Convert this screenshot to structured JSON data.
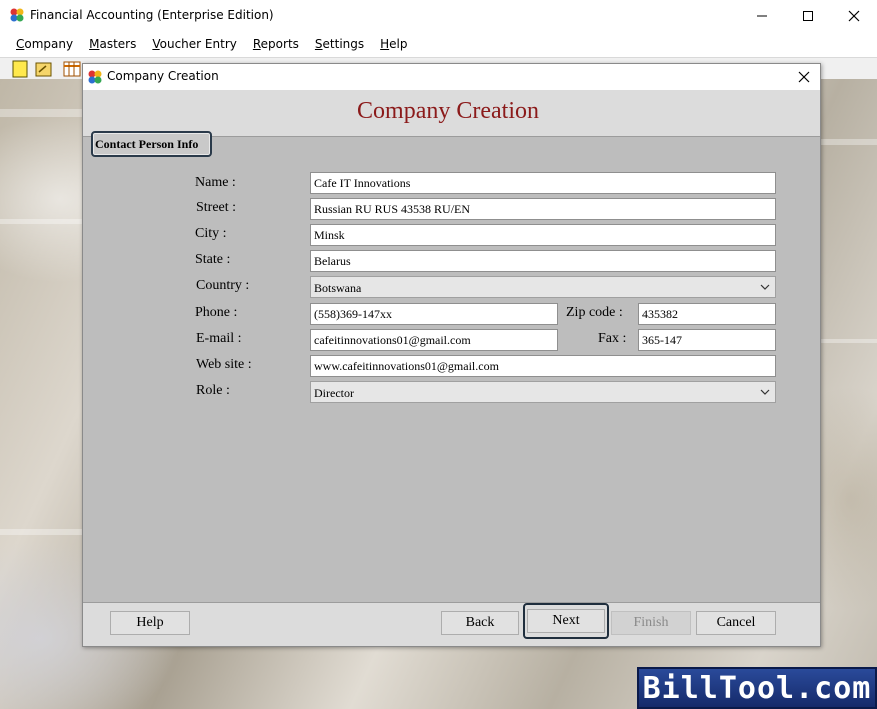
{
  "app": {
    "title": "Financial Accounting (Enterprise Edition)"
  },
  "menu": [
    {
      "pre": "",
      "ul": "C",
      "post": "ompany"
    },
    {
      "pre": "",
      "ul": "M",
      "post": "asters"
    },
    {
      "pre": "",
      "ul": "V",
      "post": "oucher Entry"
    },
    {
      "pre": "",
      "ul": "R",
      "post": "eports"
    },
    {
      "pre": "",
      "ul": "S",
      "post": "ettings"
    },
    {
      "pre": "",
      "ul": "H",
      "post": "elp"
    }
  ],
  "dialog": {
    "title": "Company Creation",
    "heading": "Company Creation",
    "section_tab": "Contact Person Info"
  },
  "form": {
    "name_label": "Name :",
    "name_value": "Cafe IT Innovations",
    "street_label": "Street :",
    "street_value": "Russian RU RUS 43538 RU/EN",
    "city_label": "City :",
    "city_value": "Minsk",
    "state_label": "State :",
    "state_value": "Belarus",
    "country_label": "Country :",
    "country_value": "Botswana",
    "phone_label": "Phone :",
    "phone_value": "(558)369-147xx",
    "zip_label": "Zip code :",
    "zip_value": "435382",
    "email_label": "E-mail :",
    "email_value": "cafeitinnovations01@gmail.com",
    "fax_label": "Fax :",
    "fax_value": "365-147",
    "website_label": "Web site :",
    "website_value": "www.cafeitinnovations01@gmail.com",
    "role_label": "Role :",
    "role_value": "Director"
  },
  "buttons": {
    "help": "Help",
    "back": "Back",
    "next": "Next",
    "finish": "Finish",
    "cancel": "Cancel"
  },
  "logo": {
    "text": "BillTool.com"
  },
  "colors": {
    "heading": "#8b1a1a",
    "body_bg": "#bdbdbd",
    "logo_bg": "#1f3a88"
  }
}
